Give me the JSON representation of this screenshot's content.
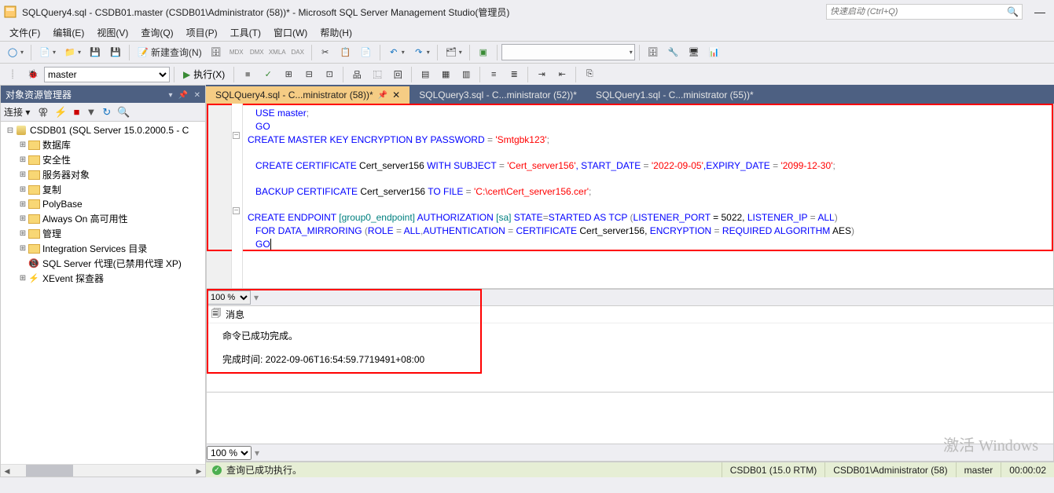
{
  "title": "SQLQuery4.sql - CSDB01.master (CSDB01\\Administrator (58))* - Microsoft SQL Server Management Studio(管理员)",
  "quick_launch_placeholder": "快速启动 (Ctrl+Q)",
  "menu": {
    "file": "文件(F)",
    "edit": "编辑(E)",
    "view": "视图(V)",
    "query": "查询(Q)",
    "project": "项目(P)",
    "tools": "工具(T)",
    "window": "窗口(W)",
    "help": "帮助(H)"
  },
  "toolbar": {
    "new_query": "新建查询(N)",
    "execute": "执行(X)",
    "db_selected": "master"
  },
  "sidebar": {
    "title": "对象资源管理器",
    "connect_label": "连接 ▾",
    "server_node": "CSDB01 (SQL Server 15.0.2000.5 - C",
    "nodes": [
      "数据库",
      "安全性",
      "服务器对象",
      "复制",
      "PolyBase",
      "Always On 高可用性",
      "管理",
      "Integration Services 目录",
      "SQL Server 代理(已禁用代理 XP)",
      "XEvent 探查器"
    ]
  },
  "tabs": [
    {
      "label": "SQLQuery4.sql - C...ministrator (58))*",
      "active": true
    },
    {
      "label": "SQLQuery3.sql - C...ministrator (52))*",
      "active": false
    },
    {
      "label": "SQLQuery1.sql - C...ministrator (55))*",
      "active": false
    }
  ],
  "sql": {
    "l1": "USE master",
    "l2": "GO",
    "l3a": "CREATE MASTER KEY ENCRYPTION BY PASSWORD",
    "l3eq": " = ",
    "l3s": "'Smtgbk123'",
    "l5a": "CREATE CERTIFICATE",
    "l5id": " Cert_server156 ",
    "l5b": "WITH SUBJECT",
    "l5s1": "'Cert_server156'",
    "l5c": ", START_DATE",
    "l5s2": "'2022-09-05'",
    "l5d": ",EXPIRY_DATE",
    "l5s3": "'2099-12-30'",
    "l7a": "BACKUP CERTIFICATE",
    "l7id": " Cert_server156 ",
    "l7b": "TO FILE",
    "l7s": "'C:\\cert\\Cert_server156.cer'",
    "l9a": "CREATE ENDPOINT",
    "l9g": " [group0_endpoint] ",
    "l9b": "AUTHORIZATION",
    "l9sa": " [sa] ",
    "l9c": "STATE",
    "l9d": "STARTED ",
    "l9e": "AS TCP",
    "l9f": " (",
    "l9g2": "LISTENER_PORT",
    "l9h": " = 5022, ",
    "l9i": "LISTENER_IP",
    "l9j": " = ",
    "l9k": "ALL",
    "l9l": ")",
    "l10a": "FOR DATA_MIRRORING",
    "l10b": " (",
    "l10c": "ROLE",
    "l10d": "ALL",
    "l10e": "AUTHENTICATION",
    "l10f": "CERTIFICATE",
    "l10g": " Cert_server156, ",
    "l10h": "ENCRYPTION",
    "l10i": "REQUIRED ALGORITHM",
    "l10j": " AES",
    "l10k": ")",
    "l11": "GO"
  },
  "zoom": "100 %",
  "messages": {
    "tab_label": "消息",
    "line1": "命令已成功完成。",
    "line2": "完成时间: 2022-09-06T16:54:59.7719491+08:00"
  },
  "status": {
    "exec_ok": "查询已成功执行。",
    "server": "CSDB01 (15.0 RTM)",
    "user": "CSDB01\\Administrator (58)",
    "db": "master",
    "time": "00:00:02"
  },
  "watermark": "激活 Windows"
}
